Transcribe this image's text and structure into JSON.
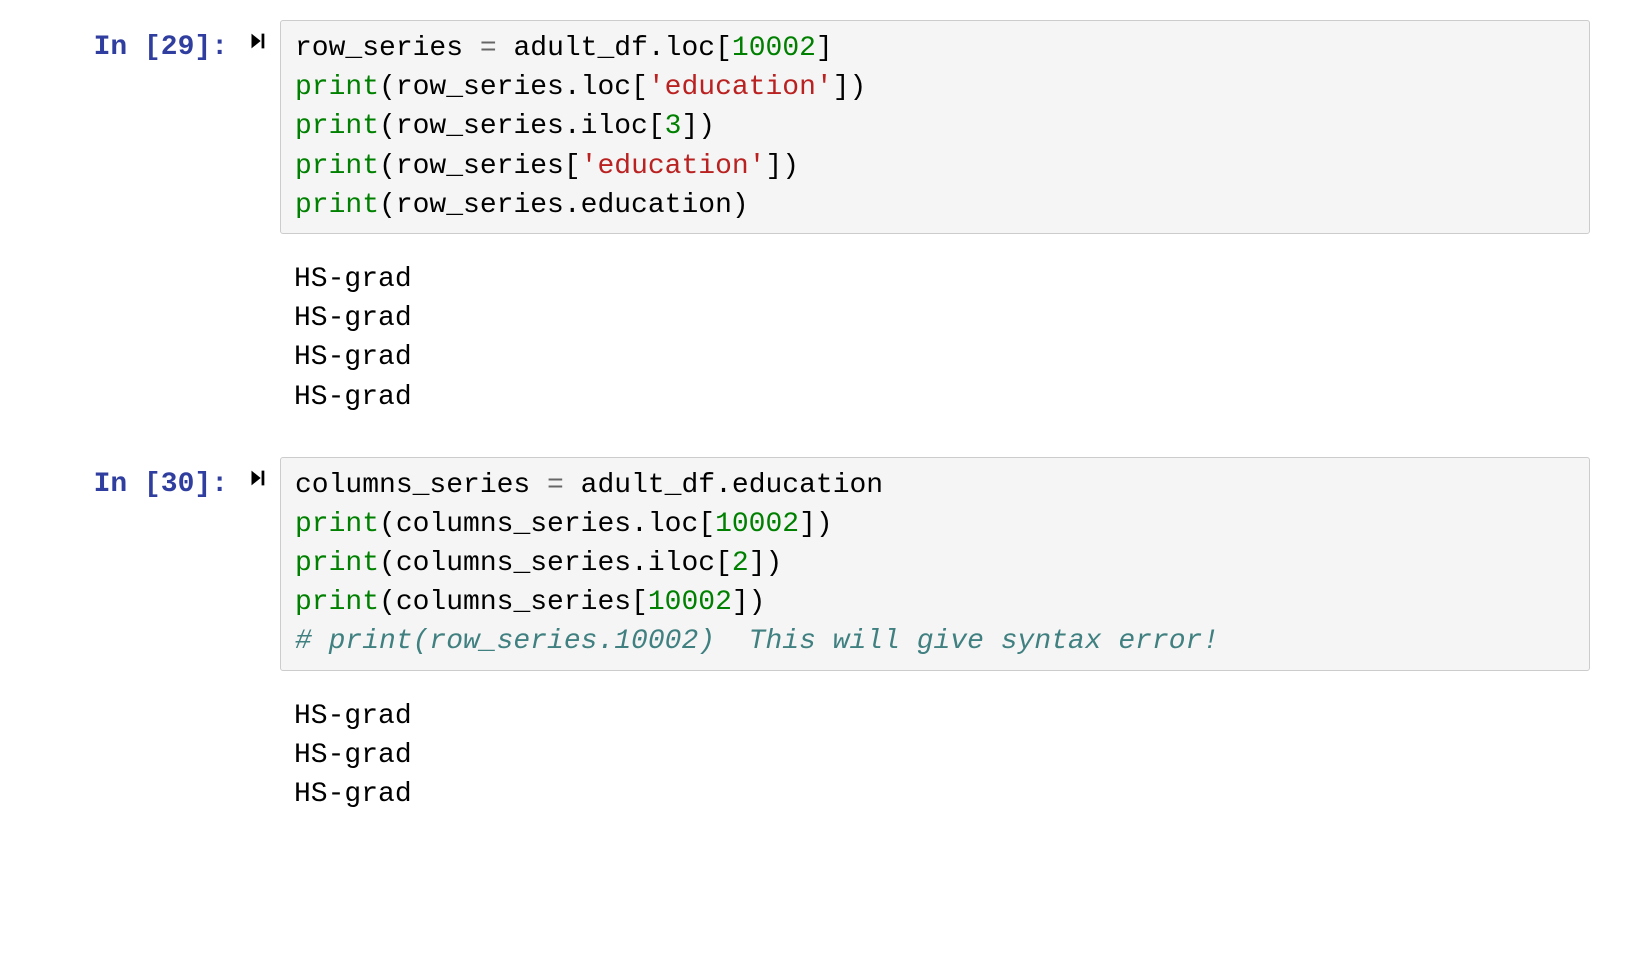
{
  "cells": [
    {
      "prompt": "In [29]:",
      "code_tokens": [
        [
          {
            "t": "plain",
            "v": "row_series "
          },
          {
            "t": "op",
            "v": "="
          },
          {
            "t": "plain",
            "v": " adult_df.loc["
          },
          {
            "t": "num",
            "v": "10002"
          },
          {
            "t": "plain",
            "v": "]"
          }
        ],
        [
          {
            "t": "func",
            "v": "print"
          },
          {
            "t": "plain",
            "v": "(row_series.loc["
          },
          {
            "t": "str",
            "v": "'education'"
          },
          {
            "t": "plain",
            "v": "])"
          }
        ],
        [
          {
            "t": "func",
            "v": "print"
          },
          {
            "t": "plain",
            "v": "(row_series.iloc["
          },
          {
            "t": "num",
            "v": "3"
          },
          {
            "t": "plain",
            "v": "])"
          }
        ],
        [
          {
            "t": "func",
            "v": "print"
          },
          {
            "t": "plain",
            "v": "(row_series["
          },
          {
            "t": "str",
            "v": "'education'"
          },
          {
            "t": "plain",
            "v": "])"
          }
        ],
        [
          {
            "t": "func",
            "v": "print"
          },
          {
            "t": "plain",
            "v": "(row_series.education)"
          }
        ]
      ],
      "output": "HS-grad\nHS-grad\nHS-grad\nHS-grad"
    },
    {
      "prompt": "In [30]:",
      "code_tokens": [
        [
          {
            "t": "plain",
            "v": "columns_series "
          },
          {
            "t": "op",
            "v": "="
          },
          {
            "t": "plain",
            "v": " adult_df.education"
          }
        ],
        [
          {
            "t": "func",
            "v": "print"
          },
          {
            "t": "plain",
            "v": "(columns_series.loc["
          },
          {
            "t": "num",
            "v": "10002"
          },
          {
            "t": "plain",
            "v": "])"
          }
        ],
        [
          {
            "t": "func",
            "v": "print"
          },
          {
            "t": "plain",
            "v": "(columns_series.iloc["
          },
          {
            "t": "num",
            "v": "2"
          },
          {
            "t": "plain",
            "v": "])"
          }
        ],
        [
          {
            "t": "func",
            "v": "print"
          },
          {
            "t": "plain",
            "v": "(columns_series["
          },
          {
            "t": "num",
            "v": "10002"
          },
          {
            "t": "plain",
            "v": "])"
          }
        ],
        [
          {
            "t": "comment",
            "v": "# print(row_series.10002)  This will give syntax error!"
          }
        ]
      ],
      "output": "HS-grad\nHS-grad\nHS-grad"
    }
  ]
}
